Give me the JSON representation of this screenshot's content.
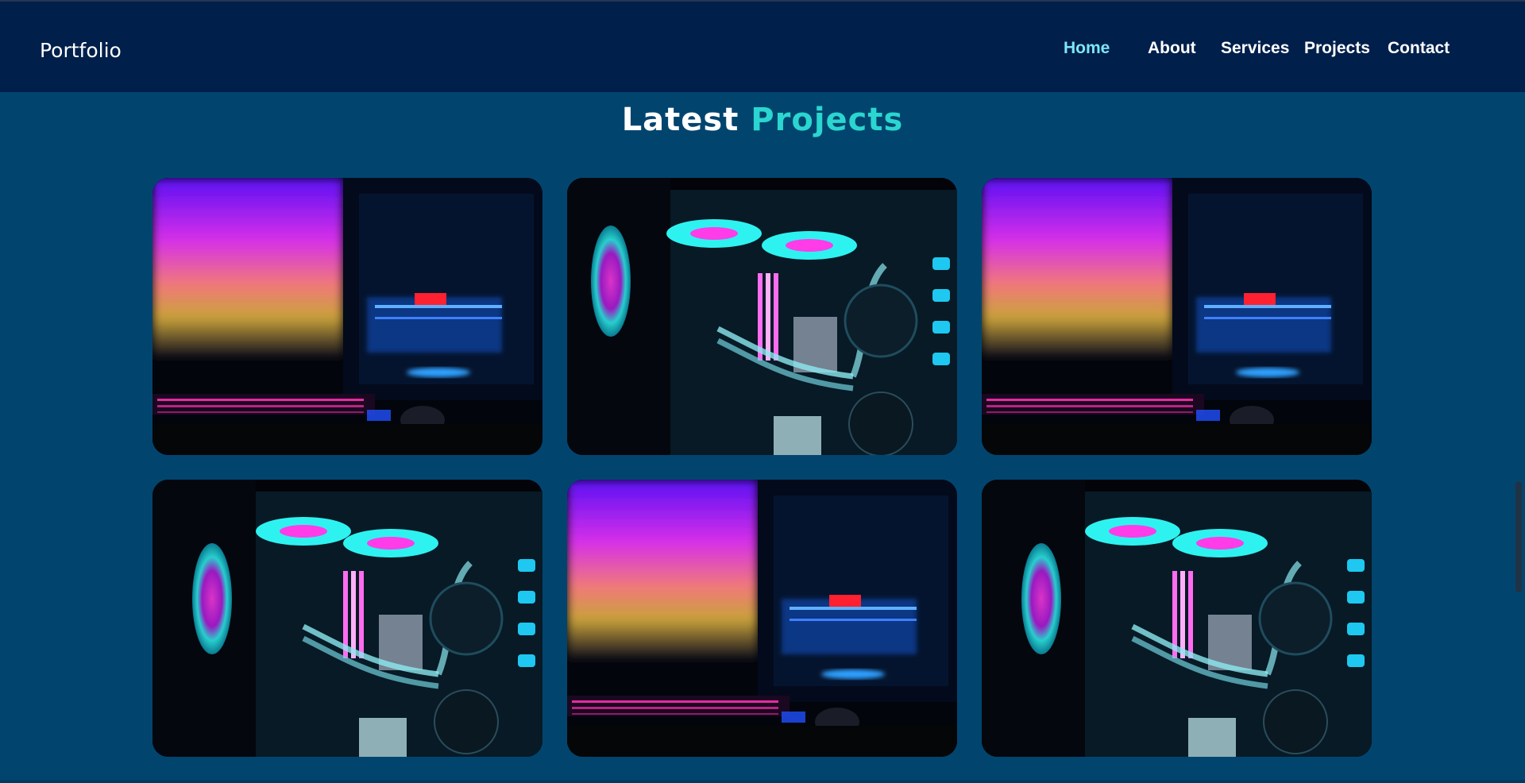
{
  "header": {
    "logo": "Portfolio",
    "nav": [
      {
        "label": "Home",
        "active": true
      },
      {
        "label": "About",
        "active": false
      },
      {
        "label": "Services",
        "active": false
      },
      {
        "label": "Projects",
        "active": false
      },
      {
        "label": "Contact",
        "active": false
      }
    ]
  },
  "section": {
    "title_part1": "Latest",
    "title_part2": "Projects"
  },
  "projects": [
    {
      "image": "gaming-pc-monitor-setup"
    },
    {
      "image": "gaming-pc-water-cooling"
    },
    {
      "image": "gaming-pc-monitor-setup"
    },
    {
      "image": "gaming-pc-water-cooling"
    },
    {
      "image": "gaming-pc-monitor-setup"
    },
    {
      "image": "gaming-pc-water-cooling"
    }
  ],
  "colors": {
    "header_bg": "#011f4b",
    "page_bg": "#01456f",
    "accent": "#2ad6cf",
    "active_nav": "#7de6f5"
  }
}
